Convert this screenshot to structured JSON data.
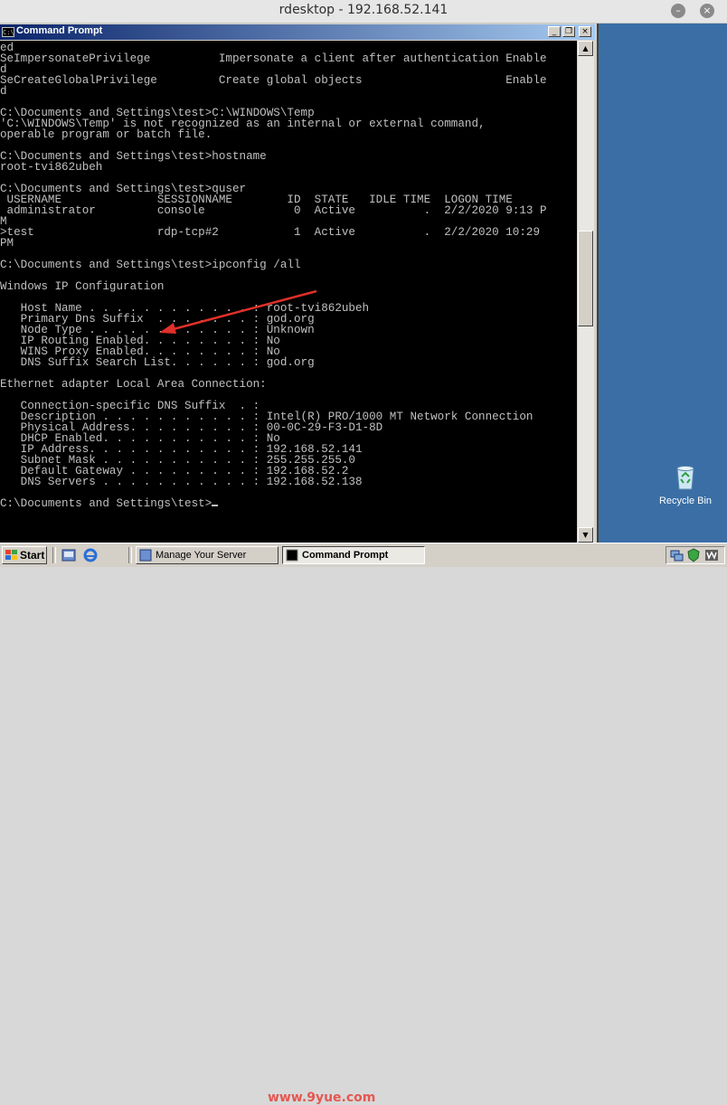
{
  "outer_window": {
    "title": "rdesktop - 192.168.52.141"
  },
  "cmd_window": {
    "title": "Command Prompt",
    "icon_text": "C:\\",
    "lines": [
      "ed",
      "SeImpersonatePrivilege          Impersonate a client after authentication Enable",
      "d",
      "SeCreateGlobalPrivilege         Create global objects                     Enable",
      "d",
      "",
      "C:\\Documents and Settings\\test>C:\\WINDOWS\\Temp",
      "'C:\\WINDOWS\\Temp' is not recognized as an internal or external command,",
      "operable program or batch file.",
      "",
      "C:\\Documents and Settings\\test>hostname",
      "root-tvi862ubeh",
      "",
      "C:\\Documents and Settings\\test>quser",
      " USERNAME              SESSIONNAME        ID  STATE   IDLE TIME  LOGON TIME",
      " administrator         console             0  Active          .  2/2/2020 9:13 P",
      "M",
      ">test                  rdp-tcp#2           1  Active          .  2/2/2020 10:29",
      "PM",
      "",
      "C:\\Documents and Settings\\test>ipconfig /all",
      "",
      "Windows IP Configuration",
      "",
      "   Host Name . . . . . . . . . . . . : root-tvi862ubeh",
      "   Primary Dns Suffix  . . . . . . . : god.org",
      "   Node Type . . . . . . . . . . . . : Unknown",
      "   IP Routing Enabled. . . . . . . . : No",
      "   WINS Proxy Enabled. . . . . . . . : No",
      "   DNS Suffix Search List. . . . . . : god.org",
      "",
      "Ethernet adapter Local Area Connection:",
      "",
      "   Connection-specific DNS Suffix  . :",
      "   Description . . . . . . . . . . . : Intel(R) PRO/1000 MT Network Connection",
      "   Physical Address. . . . . . . . . : 00-0C-29-F3-D1-8D",
      "   DHCP Enabled. . . . . . . . . . . : No",
      "   IP Address. . . . . . . . . . . . : 192.168.52.141",
      "   Subnet Mask . . . . . . . . . . . : 255.255.255.0",
      "   Default Gateway . . . . . . . . . : 192.168.52.2",
      "   DNS Servers . . . . . . . . . . . : 192.168.52.138",
      "",
      "C:\\Documents and Settings\\test>"
    ]
  },
  "desktop": {
    "recycle_bin_label": "Recycle Bin"
  },
  "taskbar": {
    "start_label": "Start",
    "buttons": [
      {
        "label": "Manage Your Server"
      },
      {
        "label": "Command Prompt"
      }
    ]
  },
  "watermark": "www.9yue.com",
  "annotation": {
    "color": "#e0302a"
  },
  "colors": {
    "console_bg": "#000000",
    "console_fg": "#c0c0c0",
    "title_gradient_start": "#0a246a",
    "title_gradient_end": "#a6caf0",
    "desktop_bg": "#3a6ea5"
  }
}
